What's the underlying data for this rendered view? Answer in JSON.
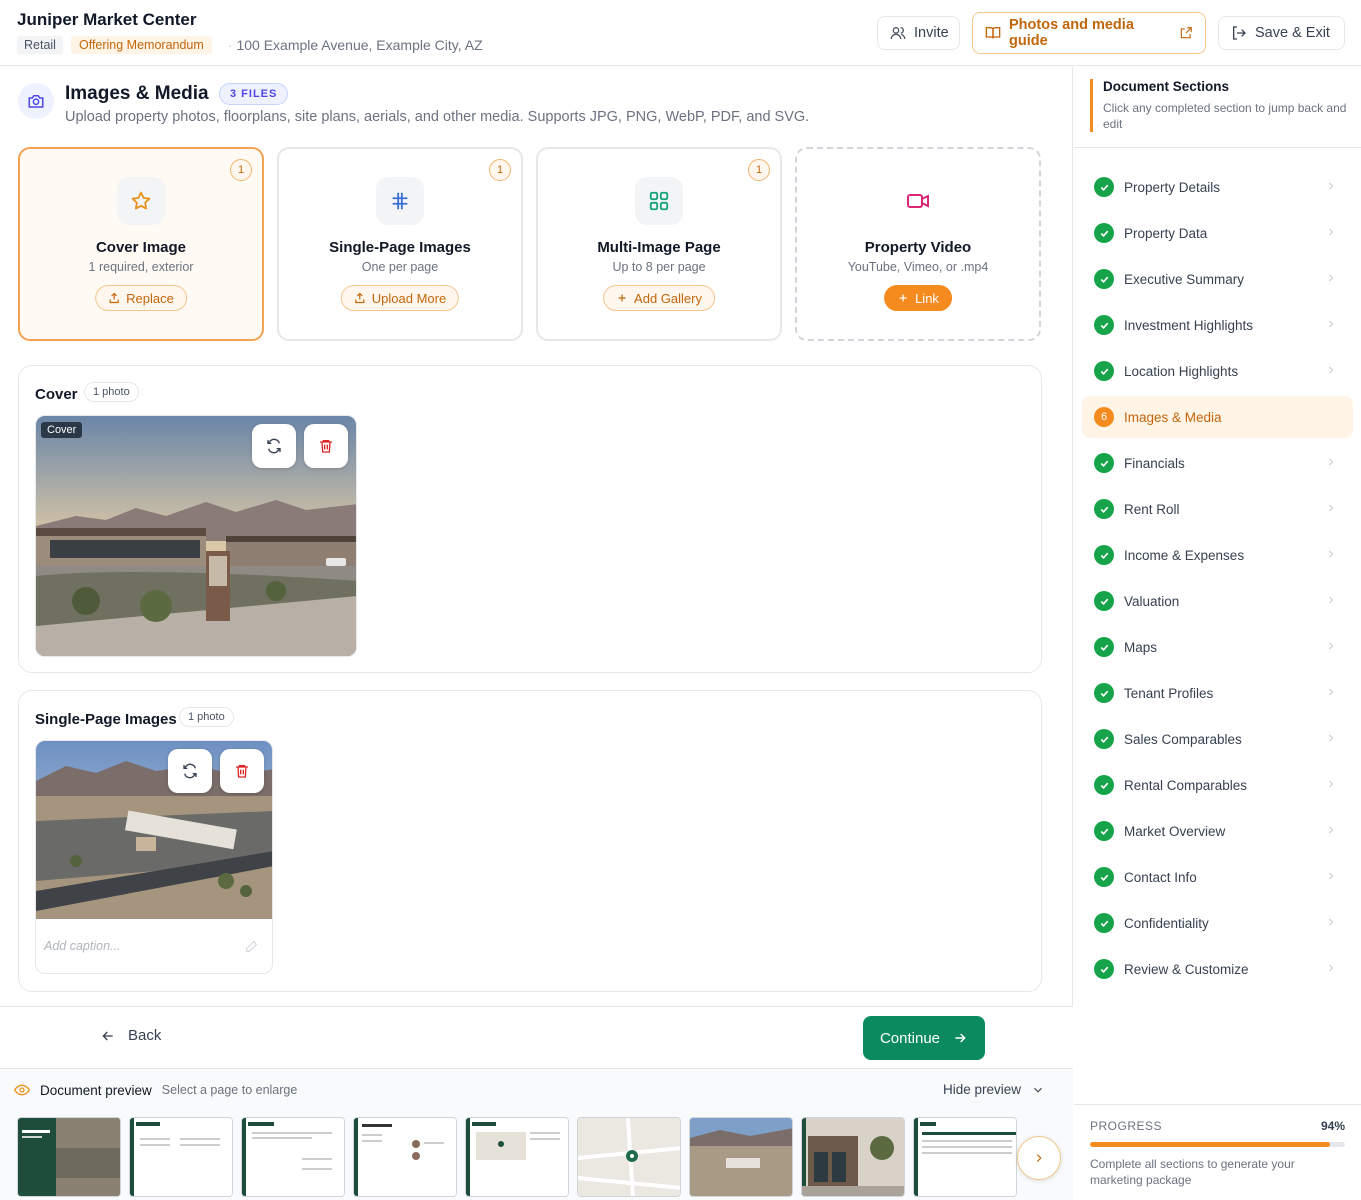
{
  "header": {
    "title": "Juniper Market Center",
    "tag_type": "Retail",
    "tag_doc": "Offering Memorandum",
    "address": "100 Example Avenue, Example City, AZ",
    "invite_label": "Invite",
    "guide_label": "Photos and media guide",
    "save_label": "Save & Exit"
  },
  "section": {
    "title": "Images & Media",
    "files_badge": "3 FILES",
    "description": "Upload property photos, floorplans, site plans, aerials, and other media. Supports JPG, PNG, WebP, PDF, and SVG."
  },
  "cards": [
    {
      "title": "Cover Image",
      "sub": "1 required, exterior",
      "button": "Replace",
      "count": "1",
      "icon": "star-icon"
    },
    {
      "title": "Single-Page Images",
      "sub": "One per page",
      "button": "Upload More",
      "count": "1",
      "icon": "hash-icon"
    },
    {
      "title": "Multi-Image Page",
      "sub": "Up to 8 per page",
      "button": "Add Gallery",
      "count": "1",
      "icon": "grid-icon"
    },
    {
      "title": "Property Video",
      "sub": "YouTube, Vimeo, or .mp4",
      "button": "Link",
      "icon": "video-icon"
    }
  ],
  "cover_panel": {
    "title": "Cover",
    "badge": "1 photo",
    "photo_label": "Cover"
  },
  "single_panel": {
    "title": "Single-Page Images",
    "badge": "1 photo",
    "caption_placeholder": "Add caption..."
  },
  "footer": {
    "back_label": "Back",
    "continue_label": "Continue"
  },
  "preview": {
    "title": "Document preview",
    "subtitle": "Select a page to enlarge",
    "hide_label": "Hide preview"
  },
  "sidebar": {
    "title": "Document Sections",
    "subtitle": "Click any completed section to jump back and edit",
    "items": [
      {
        "label": "Property Details",
        "status": "done"
      },
      {
        "label": "Property Data",
        "status": "done"
      },
      {
        "label": "Executive Summary",
        "status": "done"
      },
      {
        "label": "Investment Highlights",
        "status": "done"
      },
      {
        "label": "Location Highlights",
        "status": "done"
      },
      {
        "label": "Images & Media",
        "status": "active",
        "number": "6"
      },
      {
        "label": "Financials",
        "status": "done"
      },
      {
        "label": "Rent Roll",
        "status": "done"
      },
      {
        "label": "Income & Expenses",
        "status": "done"
      },
      {
        "label": "Valuation",
        "status": "done"
      },
      {
        "label": "Maps",
        "status": "done"
      },
      {
        "label": "Tenant Profiles",
        "status": "done"
      },
      {
        "label": "Sales Comparables",
        "status": "done"
      },
      {
        "label": "Rental Comparables",
        "status": "done"
      },
      {
        "label": "Market Overview",
        "status": "done"
      },
      {
        "label": "Contact Info",
        "status": "done"
      },
      {
        "label": "Confidentiality",
        "status": "done"
      },
      {
        "label": "Review & Customize",
        "status": "done"
      }
    ]
  },
  "progress": {
    "label": "PROGRESS",
    "value_text": "94%",
    "value": 0.94,
    "note": "Complete all sections to generate your marketing package"
  },
  "colors": {
    "accent": "#f58a1f",
    "primary": "#0b8a5f",
    "done": "#16a34a"
  }
}
